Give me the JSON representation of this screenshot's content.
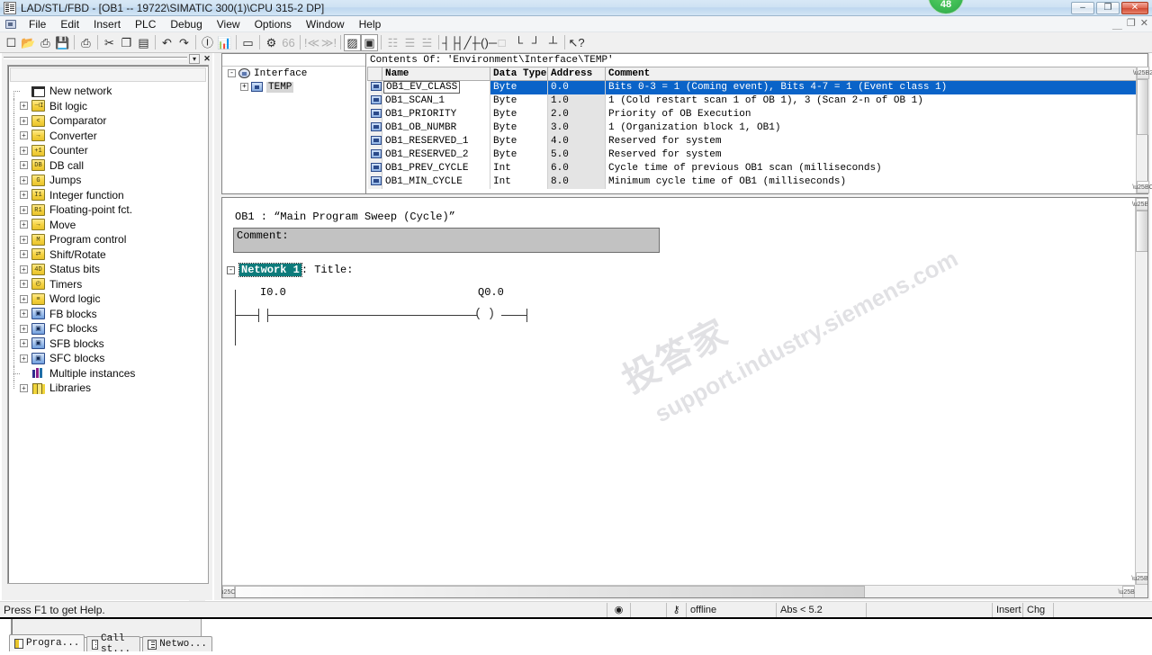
{
  "window": {
    "title": "LAD/STL/FBD  - [OB1 -- 19722\\SIMATIC 300(1)\\CPU 315-2 DP]",
    "badge_count": "48",
    "minimize": "–",
    "maximize": "❐",
    "close": "✕",
    "mdi_minimize": "＿",
    "mdi_restore": "❐",
    "mdi_close": "✕"
  },
  "menu": {
    "items": [
      "File",
      "Edit",
      "Insert",
      "PLC",
      "Debug",
      "View",
      "Options",
      "Window",
      "Help"
    ]
  },
  "toolbar": {
    "groups": [
      [
        {
          "name": "new-document-icon",
          "glyph": "☐",
          "disabled": false
        },
        {
          "name": "open-folder-icon",
          "glyph": "📂",
          "disabled": false
        },
        {
          "name": "save-as-icon",
          "glyph": "⎙",
          "disabled": false
        },
        {
          "name": "save-icon",
          "glyph": "💾",
          "disabled": false
        }
      ],
      [
        {
          "name": "print-icon",
          "glyph": "⎙",
          "disabled": false
        }
      ],
      [
        {
          "name": "cut-icon",
          "glyph": "✂",
          "disabled": false
        },
        {
          "name": "copy-icon",
          "glyph": "❐",
          "disabled": false
        },
        {
          "name": "paste-icon",
          "glyph": "▤",
          "disabled": false
        }
      ],
      [
        {
          "name": "undo-icon",
          "glyph": "↶",
          "disabled": false
        },
        {
          "name": "redo-icon",
          "glyph": "↷",
          "disabled": false
        }
      ],
      [
        {
          "name": "download-icon",
          "glyph": "Ⓘ",
          "disabled": false
        },
        {
          "name": "monitor-icon",
          "glyph": "📊",
          "disabled": false
        }
      ],
      [
        {
          "name": "insert-network-icon",
          "glyph": "▭",
          "disabled": false
        }
      ],
      [
        {
          "name": "symbol-table-icon",
          "glyph": "⚙",
          "disabled": false
        },
        {
          "name": "symbol-info-icon",
          "glyph": "66",
          "disabled": true
        }
      ],
      [
        {
          "name": "error-first-icon",
          "glyph": "!≪",
          "disabled": true
        },
        {
          "name": "error-next-icon",
          "glyph": "≫!",
          "disabled": true
        }
      ],
      [
        {
          "name": "toggle-overview-icon",
          "glyph": "▨",
          "disabled": false
        },
        {
          "name": "toggle-detail-icon",
          "glyph": "▣",
          "disabled": false
        }
      ],
      [
        {
          "name": "symbolic-representation-icon",
          "glyph": "☷",
          "disabled": true
        },
        {
          "name": "symbol-information-icon",
          "glyph": "☰",
          "disabled": true
        },
        {
          "name": "comment-icon",
          "glyph": "☱",
          "disabled": true
        }
      ],
      [
        {
          "name": "normally-open-contact-icon",
          "glyph": "┤├",
          "disabled": false
        },
        {
          "name": "normally-closed-contact-icon",
          "glyph": "┤╱├",
          "disabled": false
        },
        {
          "name": "output-coil-icon",
          "glyph": "─()─",
          "disabled": false
        },
        {
          "name": "empty-box-icon",
          "glyph": "□",
          "disabled": true
        },
        {
          "name": "branch-open-icon",
          "glyph": "└",
          "disabled": false
        },
        {
          "name": "branch-close-icon",
          "glyph": "┘",
          "disabled": false
        },
        {
          "name": "branch-connector-icon",
          "glyph": "┴",
          "disabled": false
        }
      ],
      [
        {
          "name": "context-help-icon",
          "glyph": "↖?",
          "disabled": false
        }
      ]
    ]
  },
  "element_tree": {
    "dropdown_glyph": "▾",
    "close_glyph": "✕",
    "items": [
      {
        "label": "New network",
        "icon": "network-icon",
        "icon_kind": "net",
        "expandable": false,
        "glyph": ""
      },
      {
        "label": "Bit logic",
        "icon": "folder-bit-logic-icon",
        "icon_kind": "yellow",
        "expandable": true,
        "glyph": "⊣I"
      },
      {
        "label": "Comparator",
        "icon": "folder-comparator-icon",
        "icon_kind": "yellow",
        "expandable": true,
        "glyph": "<"
      },
      {
        "label": "Converter",
        "icon": "folder-converter-icon",
        "icon_kind": "yellow",
        "expandable": true,
        "glyph": "→"
      },
      {
        "label": "Counter",
        "icon": "folder-counter-icon",
        "icon_kind": "yellow",
        "expandable": true,
        "glyph": "+1"
      },
      {
        "label": "DB call",
        "icon": "folder-db-call-icon",
        "icon_kind": "yellow",
        "expandable": true,
        "glyph": "DB"
      },
      {
        "label": "Jumps",
        "icon": "folder-jumps-icon",
        "icon_kind": "yellow",
        "expandable": true,
        "glyph": "G"
      },
      {
        "label": "Integer function",
        "icon": "folder-integer-function-icon",
        "icon_kind": "yellow",
        "expandable": true,
        "glyph": "I1"
      },
      {
        "label": "Floating-point fct.",
        "icon": "folder-floating-point-icon",
        "icon_kind": "yellow",
        "expandable": true,
        "glyph": "R1"
      },
      {
        "label": "Move",
        "icon": "folder-move-icon",
        "icon_kind": "yellow",
        "expandable": true,
        "glyph": "→"
      },
      {
        "label": "Program control",
        "icon": "folder-program-control-icon",
        "icon_kind": "yellow",
        "expandable": true,
        "glyph": "M"
      },
      {
        "label": "Shift/Rotate",
        "icon": "folder-shift-rotate-icon",
        "icon_kind": "yellow",
        "expandable": true,
        "glyph": "⇄"
      },
      {
        "label": "Status bits",
        "icon": "folder-status-bits-icon",
        "icon_kind": "yellow",
        "expandable": true,
        "glyph": "4D"
      },
      {
        "label": "Timers",
        "icon": "folder-timers-icon",
        "icon_kind": "yellow",
        "expandable": true,
        "glyph": "◴"
      },
      {
        "label": "Word logic",
        "icon": "folder-word-logic-icon",
        "icon_kind": "yellow",
        "expandable": true,
        "glyph": "≡"
      },
      {
        "label": "FB blocks",
        "icon": "fb-blocks-icon",
        "icon_kind": "blue",
        "expandable": true,
        "glyph": "▣"
      },
      {
        "label": "FC blocks",
        "icon": "fc-blocks-icon",
        "icon_kind": "blue",
        "expandable": true,
        "glyph": "▣"
      },
      {
        "label": "SFB blocks",
        "icon": "sfb-blocks-icon",
        "icon_kind": "blue",
        "expandable": true,
        "glyph": "▣"
      },
      {
        "label": "SFC blocks",
        "icon": "sfc-blocks-icon",
        "icon_kind": "blue",
        "expandable": true,
        "glyph": "▣"
      },
      {
        "label": "Multiple instances",
        "icon": "multiple-instances-icon",
        "icon_kind": "chart",
        "expandable": false,
        "glyph": ""
      },
      {
        "label": "Libraries",
        "icon": "libraries-icon",
        "icon_kind": "lib",
        "expandable": true,
        "glyph": ""
      }
    ],
    "tabs": [
      {
        "label": "Progra...",
        "icon": "program-elements-icon",
        "active": true
      },
      {
        "label": "Call st...",
        "icon": "call-structure-icon",
        "active": false
      },
      {
        "label": "Netwo...",
        "icon": "network-list-icon",
        "active": false
      }
    ],
    "bottom_tool_glyph": "↳"
  },
  "declaration": {
    "interface_tree": [
      {
        "label": "Interface",
        "level": 0,
        "expander": "-",
        "icon": "interface-icon"
      },
      {
        "label": "TEMP",
        "level": 1,
        "expander": "+",
        "icon": "temp-variable-icon"
      }
    ],
    "contents_of": "Contents Of:  'Environment\\Interface\\TEMP'",
    "columns": [
      "Name",
      "Data Type",
      "Address",
      "Comment"
    ],
    "rows": [
      {
        "name": "OB1_EV_CLASS",
        "type": "Byte",
        "address": "0.0",
        "comment": "Bits 0-3 = 1 (Coming event), Bits 4-7 = 1 (Event class 1)",
        "selected": true
      },
      {
        "name": "OB1_SCAN_1",
        "type": "Byte",
        "address": "1.0",
        "comment": "1 (Cold restart scan 1 of OB 1), 3 (Scan 2-n of OB 1)",
        "selected": false
      },
      {
        "name": "OB1_PRIORITY",
        "type": "Byte",
        "address": "2.0",
        "comment": "Priority of OB Execution",
        "selected": false
      },
      {
        "name": "OB1_OB_NUMBR",
        "type": "Byte",
        "address": "3.0",
        "comment": "1 (Organization block 1, OB1)",
        "selected": false
      },
      {
        "name": "OB1_RESERVED_1",
        "type": "Byte",
        "address": "4.0",
        "comment": "Reserved for system",
        "selected": false
      },
      {
        "name": "OB1_RESERVED_2",
        "type": "Byte",
        "address": "5.0",
        "comment": "Reserved for system",
        "selected": false
      },
      {
        "name": "OB1_PREV_CYCLE",
        "type": "Int",
        "address": "6.0",
        "comment": "Cycle time of previous OB1 scan (milliseconds)",
        "selected": false
      },
      {
        "name": "OB1_MIN_CYCLE",
        "type": "Int",
        "address": "8.0",
        "comment": "Minimum cycle time of OB1 (milliseconds)",
        "selected": false
      }
    ]
  },
  "code": {
    "block_title": "OB1 :  “Main Program Sweep (Cycle)”",
    "block_comment": "Comment:",
    "network_expander": "-",
    "network_label": "Network 1",
    "network_title": ": Title:",
    "ladder": {
      "contact_label": "I0.0",
      "coil_label": "Q0.0",
      "coil_glyph": "( )"
    },
    "watermark_line1": "投答家",
    "watermark_line2": "support.industry.siemens.com"
  },
  "statusbar": {
    "help_text": "Press F1 to get Help.",
    "cells": [
      {
        "name": "plc-connection-icon",
        "text": "◉"
      },
      {
        "name": "status-blank-1",
        "text": ""
      },
      {
        "name": "key-icon",
        "text": "⚷"
      },
      {
        "name": "online-state",
        "text": "offline"
      },
      {
        "name": "address-mode",
        "text": "Abs < 5.2"
      },
      {
        "name": "status-blank-2",
        "text": ""
      },
      {
        "name": "insert-mode",
        "text": "Insert"
      },
      {
        "name": "change-state",
        "text": "Chg"
      },
      {
        "name": "status-blank-3",
        "text": ""
      }
    ]
  },
  "colors": {
    "selection_blue": "#0a63c8",
    "network_teal": "#0d7b7b",
    "comment_gray": "#c2c2c2",
    "badge_green": "#41bf56"
  }
}
